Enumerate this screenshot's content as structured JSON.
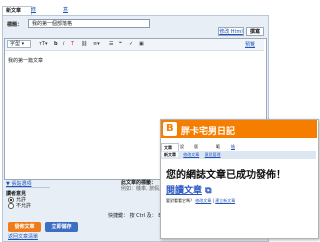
{
  "editor": {
    "tabs": [
      "新文章",
      "修改文章",
      "意見管理"
    ],
    "title_label": "標題：",
    "title_value": "我的第一個部落格",
    "edit_html_btn": "修改 Html",
    "compose_btn": "撰寫",
    "font_select": "字型",
    "toolbar_icons": [
      "font-size-icon",
      "bold-icon",
      "italic-icon",
      "color-icon",
      "link-icon",
      "align-icon",
      "list-icon",
      "quote-icon",
      "spellcheck-icon",
      "image-icon"
    ],
    "preview_link": "預覽",
    "body_text": "我的第一篇文章",
    "post_options_link": "張貼選項",
    "labels_label": "此文章的標籤：",
    "labels_example": "例如：機車, 旅假, 秋季",
    "comments_label": "讀者意見",
    "comment_allow": "允許",
    "comment_deny": "不允許",
    "shortcut_text": "快捷鍵： 按 Ctrl 及：  B = 粗體,",
    "publish_btn": "發佈文章",
    "save_btn": "立即儲存",
    "back_link": "返回文章清單"
  },
  "popup": {
    "blog_title": "胖卡宅男日記",
    "tabs": [
      "文章",
      "設定",
      "版面配置",
      "範例",
      "檢視 網誌"
    ],
    "subtabs": [
      "新文章",
      "修改文章",
      "意見管理"
    ],
    "success_msg": "您的網誌文章已成功發佈！",
    "view_post": "閱讀文章",
    "footer_prefix": "要對看看它嗎？",
    "footer_link1": "修改文章",
    "footer_sep": "|",
    "footer_link2": "建立新文章"
  },
  "colors": {
    "blogger_orange": "#f57d00",
    "publish_orange": "#ef7b1a",
    "link_blue": "#2255bb"
  }
}
